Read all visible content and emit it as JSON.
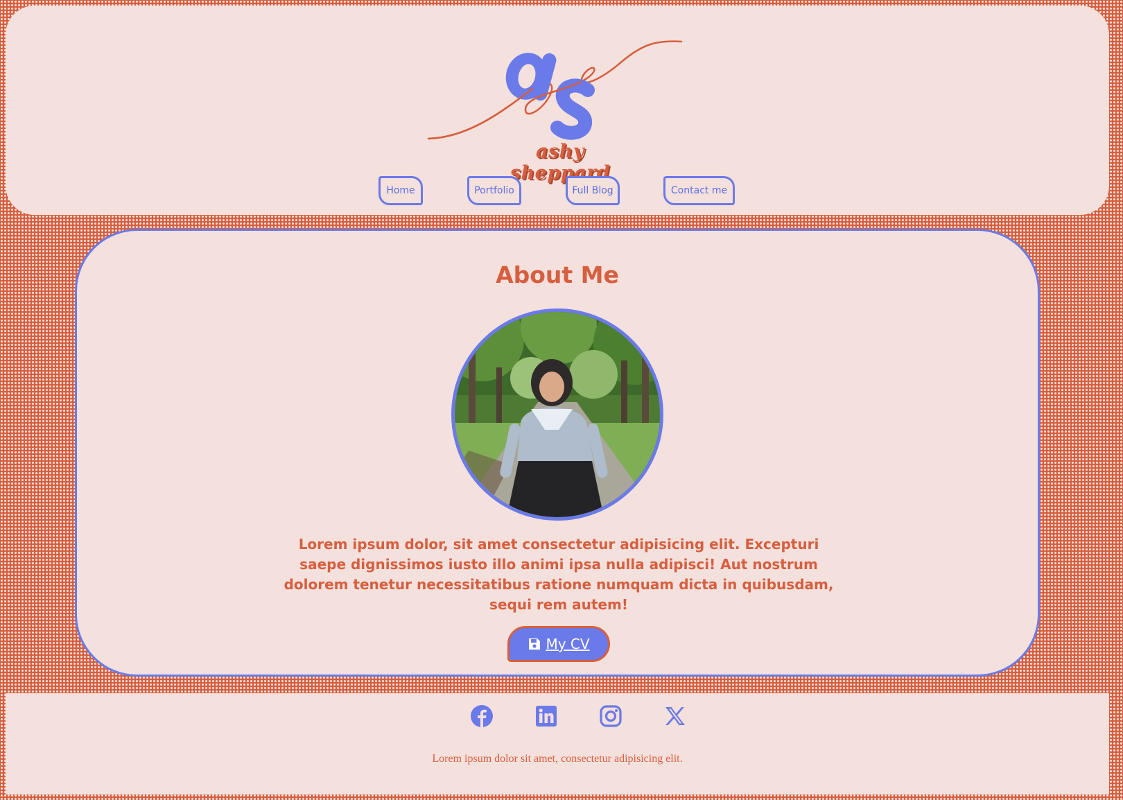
{
  "colors": {
    "accent_blue": "#6a7ae8",
    "accent_orange": "#d65f3f",
    "background": "#f4e0dc"
  },
  "header": {
    "logo": {
      "monogram": "as",
      "name": "ashy sheppard"
    },
    "nav": [
      {
        "label": "Home"
      },
      {
        "label": "Portfolio"
      },
      {
        "label": "Full Blog"
      },
      {
        "label": "Contact me"
      }
    ]
  },
  "main": {
    "title": "About Me",
    "bio": "Lorem ipsum dolor, sit amet consectetur adipisicing elit. Excepturi saepe dignissimos iusto illo animi ipsa nulla adipisci! Aut nostrum dolorem tenetur necessitatibus ratione numquam dicta in quibusdam, sequi rem autem!",
    "cv_button": {
      "icon": "save-icon",
      "label": "My CV"
    }
  },
  "footer": {
    "social": [
      {
        "icon": "facebook-icon"
      },
      {
        "icon": "linkedin-icon"
      },
      {
        "icon": "instagram-icon"
      },
      {
        "icon": "x-twitter-icon"
      }
    ],
    "text": "Lorem ipsum dolor sit amet, consectetur adipisicing elit."
  }
}
